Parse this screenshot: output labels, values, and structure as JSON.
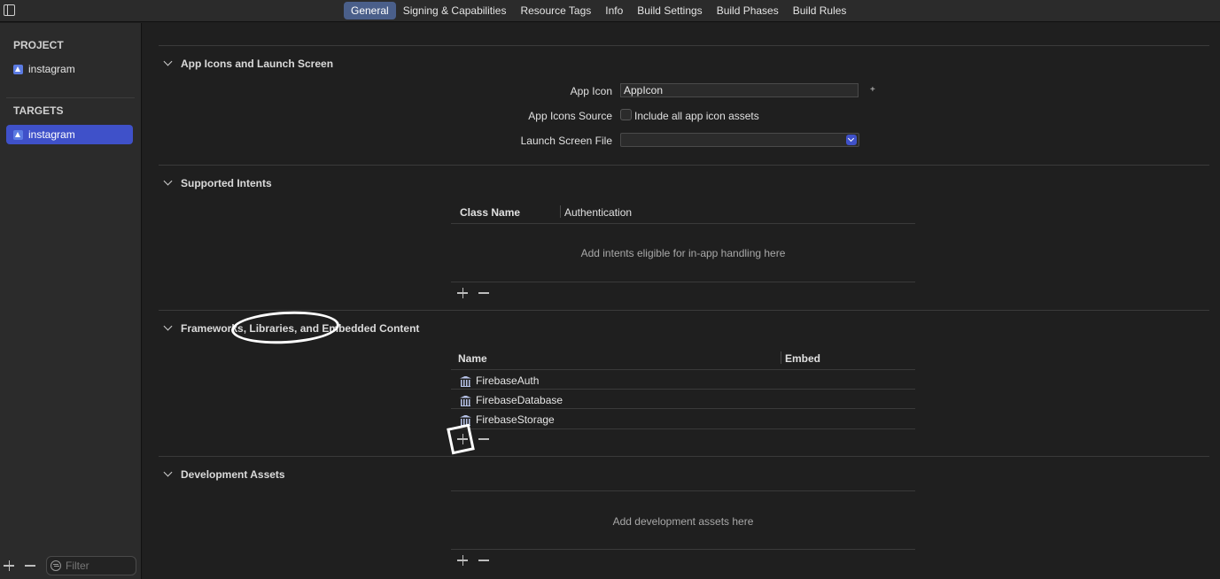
{
  "tabs": [
    {
      "label": "General",
      "active": true
    },
    {
      "label": "Signing & Capabilities"
    },
    {
      "label": "Resource Tags"
    },
    {
      "label": "Info"
    },
    {
      "label": "Build Settings"
    },
    {
      "label": "Build Phases"
    },
    {
      "label": "Build Rules"
    }
  ],
  "sidebar": {
    "project_header": "PROJECT",
    "project_item": "instagram",
    "targets_header": "TARGETS",
    "target_item": "instagram",
    "filter_placeholder": "Filter"
  },
  "sections": {
    "app_icons": {
      "title": "App Icons and Launch Screen",
      "app_icon_label": "App Icon",
      "app_icon_value": "AppIcon",
      "app_icons_source_label": "App Icons Source",
      "include_all_label": "Include all app icon assets",
      "launch_screen_label": "Launch Screen File",
      "launch_screen_value": ""
    },
    "supported_intents": {
      "title": "Supported Intents",
      "col_class_name": "Class Name",
      "col_authentication": "Authentication",
      "empty_text": "Add intents eligible for in-app handling here"
    },
    "frameworks": {
      "title": "Frameworks, Libraries, and Embedded Content",
      "col_name": "Name",
      "col_embed": "Embed",
      "items": [
        "FirebaseAuth",
        "FirebaseDatabase",
        "FirebaseStorage"
      ]
    },
    "development_assets": {
      "title": "Development Assets",
      "empty_text": "Add development assets here"
    }
  }
}
